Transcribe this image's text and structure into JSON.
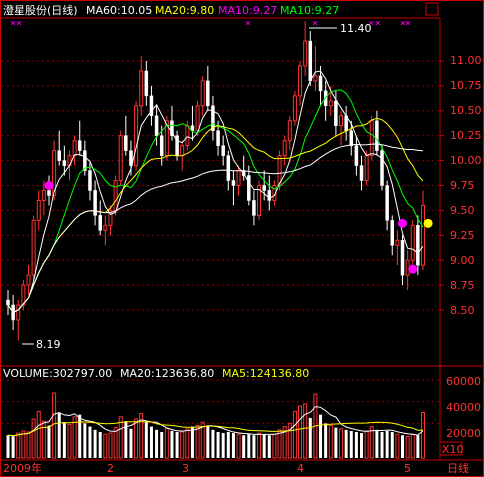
{
  "header": {
    "stock_name": "澄星股份(日线)",
    "ma60_label": "MA60:10.05",
    "ma20_label": "MA20:9.80",
    "ma10_label_a": "MA10:9.27",
    "ma10_label_b": "MA10:9.27"
  },
  "volume_header": {
    "volume_label": "VOLUME:302797.00",
    "ma20_label": "MA20:123636.80",
    "ma5_label": "MA5:124136.80"
  },
  "price_axis": {
    "ticks": [
      "11.00",
      "10.75",
      "10.50",
      "10.25",
      "10.00",
      "9.75",
      "9.50",
      "9.25",
      "9.00",
      "8.75",
      "8.50"
    ]
  },
  "volume_axis": {
    "ticks": [
      "60000",
      "40000",
      "20000"
    ],
    "unit": "X10"
  },
  "date_axis": {
    "labels": [
      "2009年",
      "2",
      "3",
      "4",
      "5"
    ],
    "period_button": "日线"
  },
  "annotations": {
    "high": "11.40",
    "low": "8.19"
  },
  "colors": {
    "up": "#ff3232",
    "down": "#ffffff",
    "ma_white": "#ffffff",
    "ma_yellow": "#ffff00",
    "ma_green": "#00ff00",
    "ma_magenta": "#ff00ff",
    "grid": "#8b0000",
    "axis_text": "#ff3232"
  },
  "chart_data": {
    "type": "candlestick",
    "title": "澄星股份(日线)",
    "price_range": [
      8.0,
      11.6
    ],
    "volume_range": [
      0,
      70000
    ],
    "volume_unit": "X10",
    "candles": [
      [
        8.6,
        8.7,
        8.45,
        8.55,
        9000
      ],
      [
        8.55,
        8.65,
        8.3,
        8.4,
        8000
      ],
      [
        8.4,
        8.6,
        8.19,
        8.55,
        11000
      ],
      [
        8.55,
        8.8,
        8.5,
        8.75,
        13000
      ],
      [
        8.75,
        8.95,
        8.65,
        8.85,
        12000
      ],
      [
        8.85,
        9.45,
        8.8,
        9.4,
        24000
      ],
      [
        9.4,
        9.7,
        9.3,
        9.6,
        31000
      ],
      [
        9.6,
        9.8,
        9.45,
        9.7,
        22000
      ],
      [
        9.7,
        9.85,
        9.55,
        9.65,
        18000
      ],
      [
        9.65,
        10.2,
        9.6,
        10.1,
        48000
      ],
      [
        10.1,
        10.3,
        9.95,
        10.0,
        30000
      ],
      [
        10.0,
        10.15,
        9.85,
        9.95,
        21000
      ],
      [
        9.95,
        10.1,
        9.8,
        10.05,
        19000
      ],
      [
        10.05,
        10.25,
        9.95,
        10.2,
        26000
      ],
      [
        10.2,
        10.4,
        10.05,
        10.1,
        28000
      ],
      [
        10.1,
        10.2,
        9.85,
        9.9,
        20000
      ],
      [
        9.9,
        10.0,
        9.6,
        9.7,
        17000
      ],
      [
        9.7,
        9.8,
        9.35,
        9.45,
        14000
      ],
      [
        9.45,
        9.6,
        9.25,
        9.3,
        12000
      ],
      [
        9.3,
        9.45,
        9.15,
        9.35,
        10000
      ],
      [
        9.35,
        9.55,
        9.25,
        9.5,
        11000
      ],
      [
        9.5,
        9.85,
        9.45,
        9.8,
        16000
      ],
      [
        9.8,
        10.3,
        9.75,
        10.25,
        26000
      ],
      [
        10.25,
        10.45,
        10.05,
        10.1,
        22000
      ],
      [
        10.1,
        10.2,
        9.85,
        9.95,
        15000
      ],
      [
        9.95,
        10.6,
        9.9,
        10.55,
        24000
      ],
      [
        10.55,
        11.05,
        10.45,
        10.9,
        29000
      ],
      [
        10.9,
        11.0,
        10.55,
        10.65,
        21000
      ],
      [
        10.65,
        10.75,
        10.35,
        10.45,
        17000
      ],
      [
        10.45,
        10.55,
        10.15,
        10.25,
        14000
      ],
      [
        10.25,
        10.35,
        9.95,
        10.05,
        12000
      ],
      [
        10.05,
        10.45,
        10.0,
        10.4,
        15000
      ],
      [
        10.4,
        10.55,
        10.2,
        10.25,
        13000
      ],
      [
        10.25,
        10.3,
        10.0,
        10.05,
        12000
      ],
      [
        10.05,
        10.2,
        9.9,
        10.15,
        12000
      ],
      [
        10.15,
        10.4,
        10.1,
        10.35,
        15000
      ],
      [
        10.35,
        10.55,
        10.2,
        10.3,
        17000
      ],
      [
        10.3,
        10.6,
        10.25,
        10.55,
        18000
      ],
      [
        10.55,
        10.85,
        10.45,
        10.8,
        21000
      ],
      [
        10.8,
        10.95,
        10.5,
        10.55,
        18000
      ],
      [
        10.55,
        10.65,
        10.2,
        10.3,
        14000
      ],
      [
        10.3,
        10.4,
        10.05,
        10.15,
        12000
      ],
      [
        10.15,
        10.25,
        9.95,
        10.05,
        11000
      ],
      [
        10.05,
        10.1,
        9.7,
        9.8,
        12000
      ],
      [
        9.8,
        9.9,
        9.55,
        9.75,
        11000
      ],
      [
        9.75,
        9.95,
        9.65,
        9.9,
        10000
      ],
      [
        9.9,
        10.05,
        9.8,
        9.85,
        9000
      ],
      [
        9.85,
        9.95,
        9.55,
        9.6,
        10000
      ],
      [
        9.6,
        9.7,
        9.35,
        9.45,
        9000
      ],
      [
        9.45,
        9.8,
        9.4,
        9.75,
        11000
      ],
      [
        9.75,
        9.9,
        9.6,
        9.7,
        10000
      ],
      [
        9.7,
        9.85,
        9.5,
        9.6,
        9000
      ],
      [
        9.6,
        9.8,
        9.55,
        9.75,
        10000
      ],
      [
        9.75,
        10.1,
        9.7,
        10.05,
        14000
      ],
      [
        10.05,
        10.25,
        9.95,
        10.2,
        17000
      ],
      [
        10.2,
        10.45,
        10.1,
        10.4,
        20000
      ],
      [
        10.4,
        10.7,
        10.35,
        10.65,
        31000
      ],
      [
        10.65,
        11.0,
        10.55,
        10.95,
        36000
      ],
      [
        10.95,
        11.4,
        10.85,
        11.2,
        38000
      ],
      [
        11.2,
        11.3,
        10.75,
        10.8,
        25000
      ],
      [
        10.8,
        11.15,
        10.7,
        10.85,
        47000
      ],
      [
        10.85,
        10.95,
        10.55,
        10.7,
        28000
      ],
      [
        10.7,
        10.8,
        10.4,
        10.55,
        20000
      ],
      [
        10.55,
        10.75,
        10.45,
        10.6,
        18000
      ],
      [
        10.6,
        10.7,
        10.25,
        10.35,
        16000
      ],
      [
        10.35,
        10.5,
        10.15,
        10.45,
        15000
      ],
      [
        10.45,
        10.55,
        10.2,
        10.3,
        14000
      ],
      [
        10.3,
        10.4,
        10.05,
        10.15,
        13000
      ],
      [
        10.15,
        10.25,
        9.85,
        9.95,
        12000
      ],
      [
        9.95,
        10.05,
        9.7,
        9.8,
        11000
      ],
      [
        9.8,
        10.1,
        9.75,
        10.05,
        13000
      ],
      [
        10.05,
        10.45,
        10.0,
        10.4,
        17000
      ],
      [
        10.4,
        10.5,
        10.05,
        10.1,
        14000
      ],
      [
        10.1,
        10.15,
        9.7,
        9.75,
        12000
      ],
      [
        9.75,
        9.8,
        9.3,
        9.4,
        13000
      ],
      [
        9.4,
        9.45,
        9.05,
        9.15,
        12000
      ],
      [
        9.15,
        9.3,
        8.95,
        9.2,
        10000
      ],
      [
        9.2,
        9.25,
        8.75,
        8.85,
        9000
      ],
      [
        8.85,
        9.1,
        8.7,
        9.0,
        8000
      ],
      [
        9.0,
        9.4,
        8.95,
        9.35,
        10000
      ],
      [
        9.35,
        9.45,
        8.85,
        8.95,
        9000
      ],
      [
        8.95,
        9.7,
        8.9,
        9.55,
        30000
      ]
    ]
  }
}
